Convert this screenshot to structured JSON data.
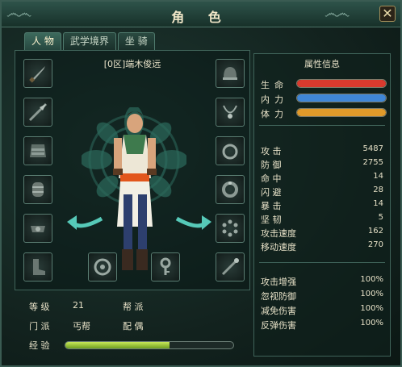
{
  "window": {
    "title": "角 色",
    "close_glyph": "✕"
  },
  "tabs": [
    {
      "label": "人 物",
      "active": true
    },
    {
      "label": "武学境界",
      "active": false
    },
    {
      "label": "坐 骑",
      "active": false
    }
  ],
  "character": {
    "name": "[0区]端木俊远"
  },
  "slots_left": [
    "dagger-icon",
    "spear-icon",
    "armor-icon",
    "bracer-icon",
    "belt-icon",
    "boots-icon"
  ],
  "slots_right": [
    "helmet-icon",
    "necklace-icon",
    "ring-icon",
    "bracelet-icon",
    "prayer-beads-icon",
    "staff-icon"
  ],
  "slots_bottom": [
    "medallion-icon",
    "key-icon"
  ],
  "info": {
    "level_label": "等 级",
    "level_value": "21",
    "sect_label": "门 派",
    "sect_value": "丐帮",
    "gang_label": "帮 派",
    "gang_value": "",
    "spouse_label": "配 偶",
    "spouse_value": "",
    "exp_label": "经 验",
    "exp_fraction": 0.62
  },
  "attributes": {
    "header": "属性信息",
    "bars": [
      {
        "label": "生命",
        "color": "#d93a2e",
        "fill": 1.0
      },
      {
        "label": "内力",
        "color": "#3f86d6",
        "fill": 1.0
      },
      {
        "label": "体力",
        "color": "#e09a2a",
        "fill": 1.0
      }
    ],
    "stats": [
      {
        "label": "攻 击",
        "value": "5487"
      },
      {
        "label": "防 御",
        "value": "2755"
      },
      {
        "label": "命 中",
        "value": "14"
      },
      {
        "label": "闪 避",
        "value": "28"
      },
      {
        "label": "暴 击",
        "value": "14"
      },
      {
        "label": "坚 韧",
        "value": "5"
      },
      {
        "label": "攻击速度",
        "value": "162"
      },
      {
        "label": "移动速度",
        "value": "270"
      }
    ],
    "bonuses": [
      {
        "label": "攻击增强",
        "value": "100%"
      },
      {
        "label": "忽视防御",
        "value": "100%"
      },
      {
        "label": "减免伤害",
        "value": "100%"
      },
      {
        "label": "反弹伤害",
        "value": "100%"
      }
    ]
  }
}
